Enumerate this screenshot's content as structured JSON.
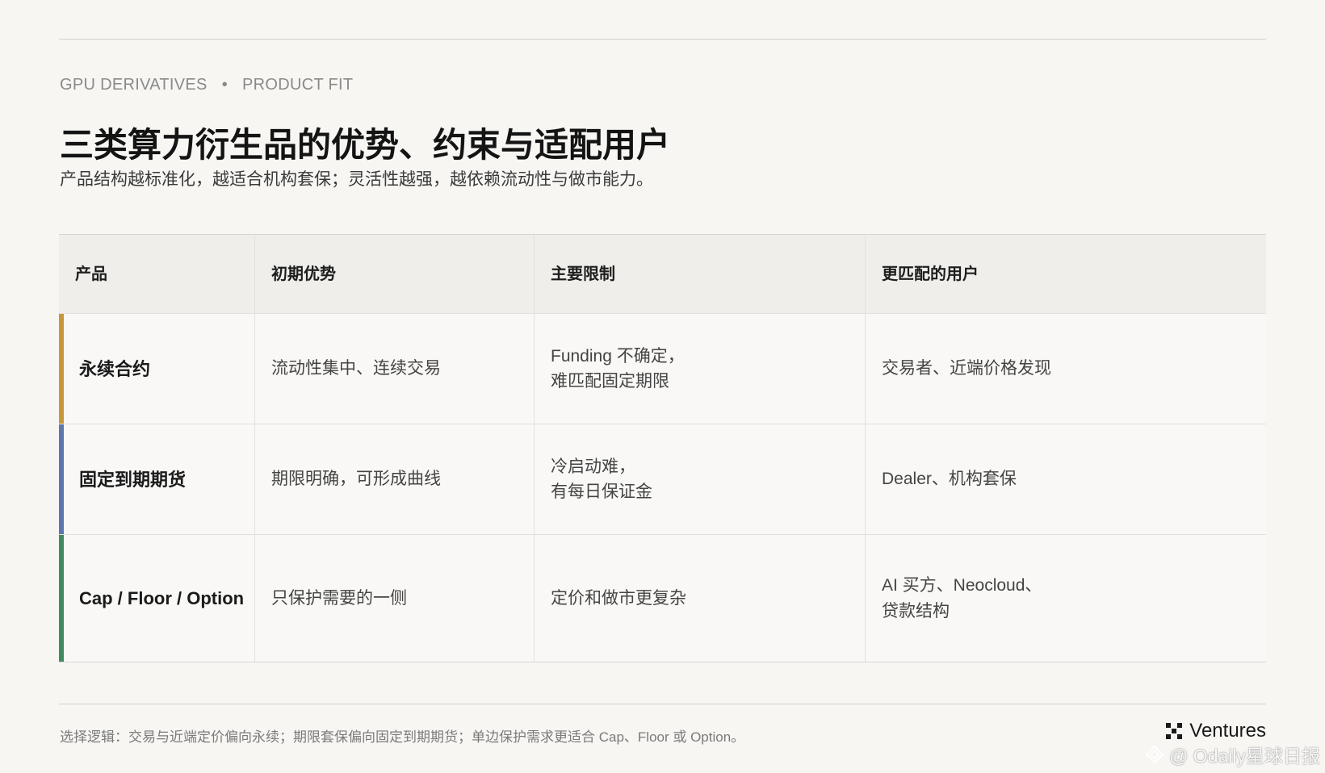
{
  "eyebrow": {
    "left": "GPU DERIVATIVES",
    "separator": "•",
    "right": "PRODUCT FIT"
  },
  "title": "三类算力衍生品的优势、约束与适配用户",
  "subtitle": "产品结构越标准化，越适合机构套保；灵活性越强，越依赖流动性与做市能力。",
  "table": {
    "headers": [
      "产品",
      "初期优势",
      "主要限制",
      "更匹配的用户"
    ],
    "rows": [
      {
        "product": "永续合约",
        "advantage": "流动性集中、连续交易",
        "limitation": "Funding 不确定，\n难匹配固定期限",
        "users": "交易者、近端价格发现",
        "accent": "#c9973b"
      },
      {
        "product": "固定到期期货",
        "advantage": "期限明确，可形成曲线",
        "limitation": "冷启动难，\n有每日保证金",
        "users": "Dealer、机构套保",
        "accent": "#5b77ad"
      },
      {
        "product": "Cap / Floor / Option",
        "advantage": "只保护需要的一侧",
        "limitation": "定价和做市更复杂",
        "users": "AI 买方、Neocloud、\n贷款结构",
        "accent": "#3f8a5f"
      }
    ]
  },
  "footnote": "选择逻辑：交易与近端定价偏向永续；期限套保偏向固定到期期货；单边保护需求更适合 Cap、Floor 或 Option。",
  "brand": {
    "name": "Ventures",
    "icon": "x-logo-icon"
  },
  "watermark": {
    "text": "@ Odaily星球日报",
    "icon": "odaily-logo-icon"
  }
}
